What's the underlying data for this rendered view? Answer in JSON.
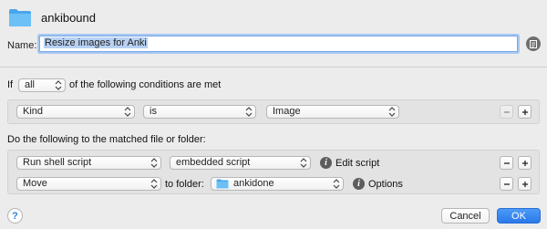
{
  "header": {
    "title": "ankibound",
    "icon": "folder-icon"
  },
  "name": {
    "label": "Name:",
    "value": "Resize images for Anki"
  },
  "conditions": {
    "if_label": "If",
    "match_value": "all",
    "suffix": "of the following conditions are met",
    "rows": [
      {
        "attribute": "Kind",
        "operator": "is",
        "value": "Image"
      }
    ]
  },
  "actions": {
    "heading": "Do the following to the matched file or folder:",
    "rows": [
      {
        "action": "Run shell script",
        "option": "embedded script",
        "info_label": "Edit script"
      },
      {
        "action": "Move",
        "connector": "to folder:",
        "folder": "ankidone",
        "info_label": "Options"
      }
    ]
  },
  "footer": {
    "help": "?",
    "cancel": "Cancel",
    "ok": "OK"
  },
  "colors": {
    "accent": "#2a78ea",
    "folder": "#5cb3f2"
  }
}
